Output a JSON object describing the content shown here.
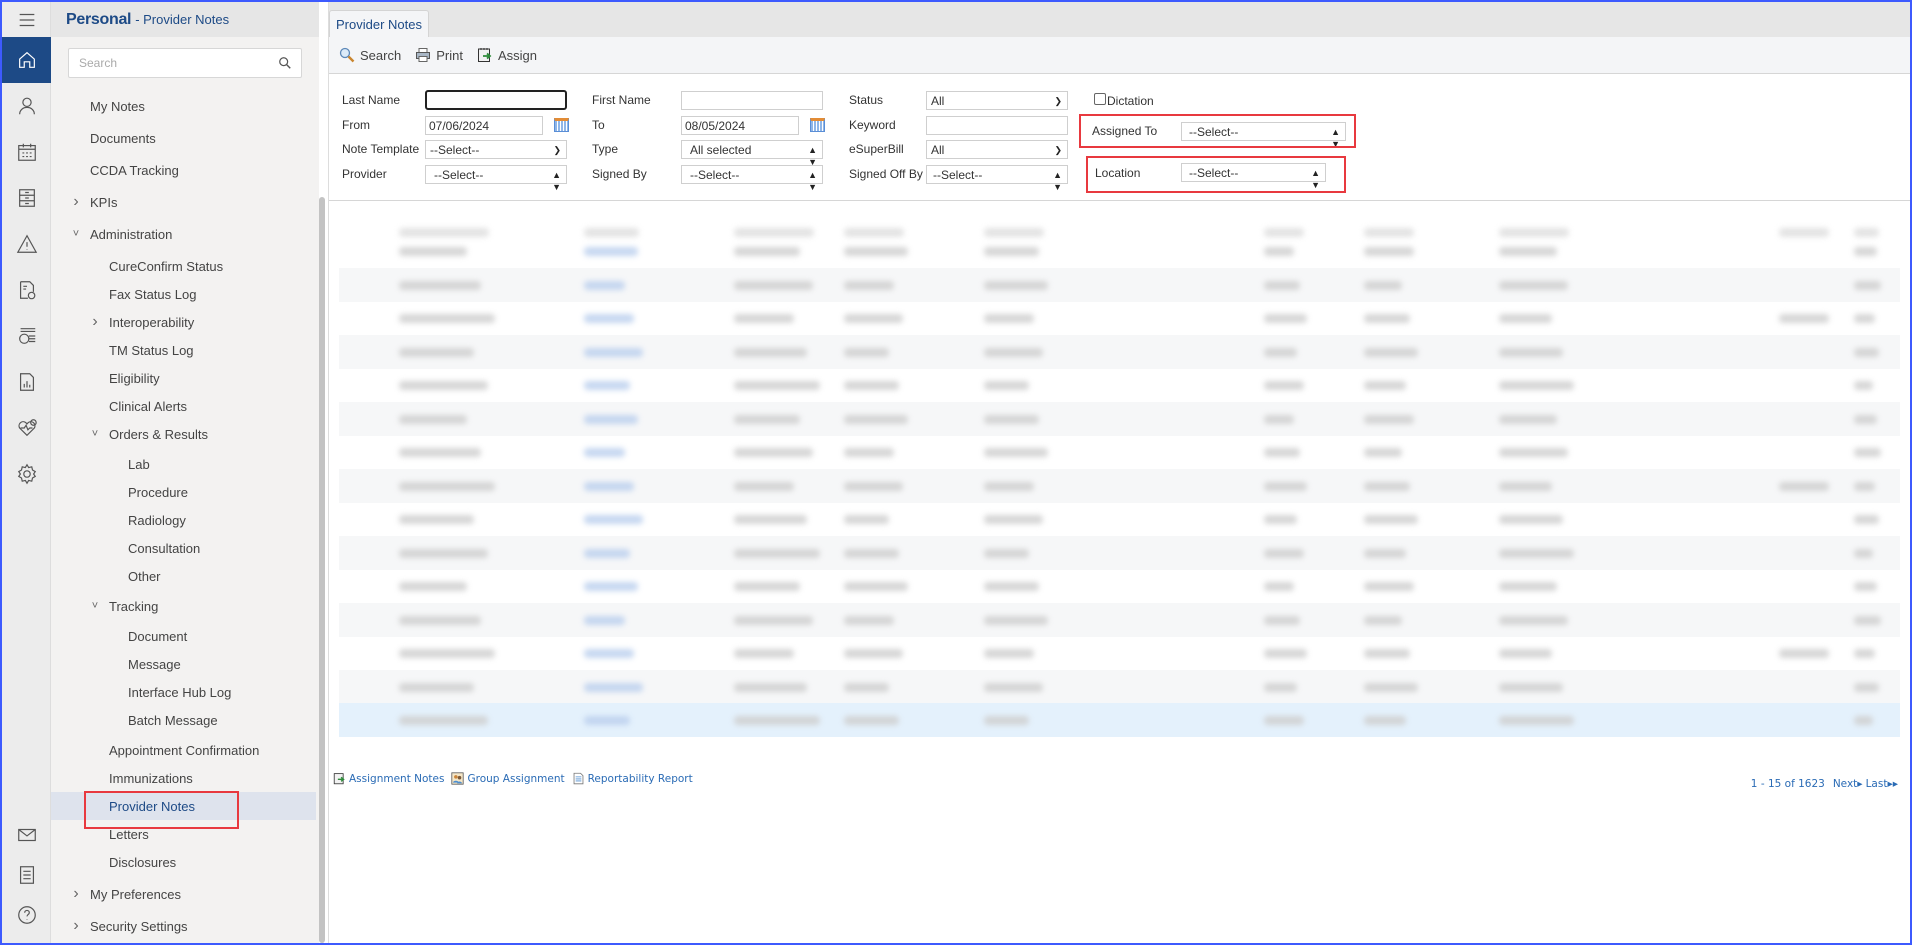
{
  "rail": {
    "items": [
      {
        "icon": "home-icon",
        "active": true
      },
      {
        "icon": "user-icon"
      },
      {
        "icon": "calendar-icon"
      },
      {
        "icon": "cabinet-icon"
      },
      {
        "icon": "warning-icon"
      },
      {
        "icon": "billing-document-icon"
      },
      {
        "icon": "payments-icon"
      },
      {
        "icon": "report-chart-icon"
      },
      {
        "icon": "health-icon"
      },
      {
        "icon": "gear-icon"
      }
    ],
    "bottom": [
      {
        "icon": "mail-icon"
      },
      {
        "icon": "notes-icon"
      },
      {
        "icon": "help-icon"
      }
    ]
  },
  "nav": {
    "title": "Personal",
    "subtitle": "- Provider Notes",
    "search_placeholder": "Search",
    "items": [
      {
        "label": "My Notes",
        "level": 0
      },
      {
        "label": "Documents",
        "level": 0
      },
      {
        "label": "CCDA Tracking",
        "level": 0
      },
      {
        "label": "KPIs",
        "level": 0,
        "expander": "collapsed"
      },
      {
        "label": "Administration",
        "level": 0,
        "expander": "expanded"
      },
      {
        "label": "CureConfirm Status",
        "level": 1
      },
      {
        "label": "Fax Status Log",
        "level": 1
      },
      {
        "label": "Interoperability",
        "level": 1,
        "expander": "collapsed"
      },
      {
        "label": "TM Status Log",
        "level": 1
      },
      {
        "label": "Eligibility",
        "level": 1
      },
      {
        "label": "Clinical Alerts",
        "level": 1
      },
      {
        "label": "Orders & Results",
        "level": 1,
        "expander": "expanded"
      },
      {
        "label": "Lab",
        "level": 2
      },
      {
        "label": "Procedure",
        "level": 2
      },
      {
        "label": "Radiology",
        "level": 2
      },
      {
        "label": "Consultation",
        "level": 2
      },
      {
        "label": "Other",
        "level": 2
      },
      {
        "label": "Tracking",
        "level": 1,
        "expander": "expanded"
      },
      {
        "label": "Document",
        "level": 2
      },
      {
        "label": "Message",
        "level": 2
      },
      {
        "label": "Interface Hub Log",
        "level": 2
      },
      {
        "label": "Batch Message",
        "level": 2
      },
      {
        "label": "Appointment Confirmation",
        "level": 1
      },
      {
        "label": "Immunizations",
        "level": 1
      },
      {
        "label": "Provider Notes",
        "level": 1,
        "selected": true
      },
      {
        "label": "Letters",
        "level": 1
      },
      {
        "label": "Disclosures",
        "level": 1
      },
      {
        "label": "My Preferences",
        "level": 0,
        "expander": "collapsed"
      },
      {
        "label": "Security Settings",
        "level": 0,
        "expander": "collapsed"
      }
    ]
  },
  "main": {
    "tab_label": "Provider Notes",
    "toolbar": {
      "search_label": "Search",
      "print_label": "Print",
      "assign_label": "Assign"
    },
    "filters": {
      "last_name": {
        "label": "Last Name",
        "value": ""
      },
      "first_name": {
        "label": "First Name",
        "value": ""
      },
      "status": {
        "label": "Status",
        "value": "All"
      },
      "dictation": {
        "label": "Dictation",
        "checked": false
      },
      "from": {
        "label": "From",
        "value": "07/06/2024"
      },
      "to": {
        "label": "To",
        "value": "08/05/2024"
      },
      "keyword": {
        "label": "Keyword",
        "value": ""
      },
      "assigned_to": {
        "label": "Assigned To",
        "value": "--Select--"
      },
      "note_template": {
        "label": "Note Template",
        "value": "--Select--"
      },
      "type": {
        "label": "Type",
        "value": "All selected"
      },
      "esuperbill": {
        "label": "eSuperBill",
        "value": "All"
      },
      "provider": {
        "label": "Provider",
        "value": "--Select--"
      },
      "signed_by": {
        "label": "Signed By",
        "value": "--Select--"
      },
      "signed_off_by": {
        "label": "Signed Off By",
        "value": "--Select--"
      },
      "location": {
        "label": "Location",
        "value": "--Select--"
      }
    },
    "grid": {
      "note": "Table contents are blurred/redacted in the screenshot",
      "row_count": 15,
      "selected_row": 15
    },
    "footer": {
      "assignment_notes": "Assignment Notes",
      "group_assignment": "Group Assignment",
      "reportability_report": "Reportability Report"
    },
    "pager": {
      "range": "1 - 15 of 1623",
      "next": "Next",
      "last": "Last"
    }
  },
  "colors": {
    "brand": "#1d4a86",
    "highlight": "#e8393f",
    "link": "#2a6bb5",
    "selected_row": "#e4f1fc"
  }
}
